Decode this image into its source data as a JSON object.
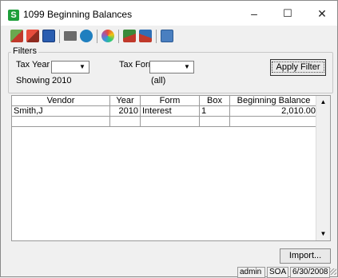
{
  "window": {
    "title": "1099 Beginning Balances",
    "app_letter": "S",
    "minimize": "–",
    "maximize": "☐",
    "close": "✕"
  },
  "toolbar": {
    "icons": [
      "export-icon",
      "print-report-icon",
      "save-icon",
      "printer-icon",
      "help-icon",
      "color-palette-icon",
      "checklist-icon",
      "reconcile-icon",
      "calculator-icon"
    ]
  },
  "filters": {
    "group_label": "Filters",
    "tax_year_label": "Tax Year",
    "tax_year_value": "",
    "tax_form_label": "Tax Form",
    "tax_form_value": "",
    "showing_label": "Showing",
    "showing_year": "2010",
    "showing_form": "(all)",
    "apply_label": "Apply Filter"
  },
  "grid": {
    "columns": [
      "Vendor",
      "Year",
      "Form",
      "Box",
      "Beginning Balance"
    ],
    "rows": [
      [
        "Smith,J",
        "2010",
        "Interest",
        "1",
        "2,010.00"
      ],
      [
        "",
        "",
        "",
        "",
        ""
      ]
    ],
    "scroll_up": "▲",
    "scroll_down": "▼"
  },
  "buttons": {
    "import_label": "Import..."
  },
  "status_bar": {
    "user": "admin",
    "company": "SOA",
    "date": "6/30/2008"
  }
}
